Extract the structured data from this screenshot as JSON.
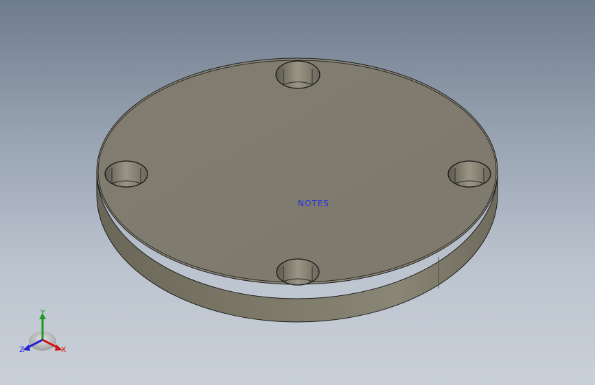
{
  "viewport": {
    "part": "circular-flange-with-four-holes",
    "background_top": "#6f7c8c",
    "background_bottom": "#c9d0d9",
    "part_face_color": "#807b6f",
    "part_side_color": "#6f6b5d"
  },
  "annotation": {
    "label": "NOTES",
    "color": "#1f2ee8"
  },
  "triad": {
    "x_label": "X",
    "y_label": "Y",
    "z_label": "Z",
    "x_color": "#d11616",
    "y_color": "#1a9b1a",
    "z_color": "#2222cc"
  }
}
